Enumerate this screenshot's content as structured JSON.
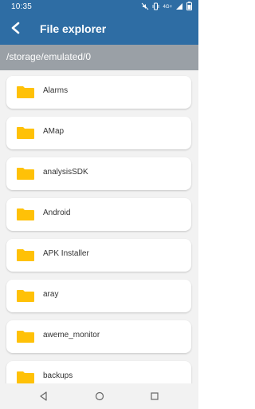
{
  "status_bar": {
    "time": "10:35",
    "signal_text": "4G+"
  },
  "app_bar": {
    "title": "File explorer"
  },
  "path_bar": {
    "path": "/storage/emulated/0"
  },
  "folders": [
    {
      "name": "Alarms"
    },
    {
      "name": "AMap"
    },
    {
      "name": "analysisSDK"
    },
    {
      "name": "Android"
    },
    {
      "name": "APK Installer"
    },
    {
      "name": "aray"
    },
    {
      "name": "aweme_monitor"
    },
    {
      "name": "backups"
    }
  ],
  "colors": {
    "primary": "#2e6da4",
    "path_bg": "#9aa0a6",
    "folder": "#ffc107"
  }
}
